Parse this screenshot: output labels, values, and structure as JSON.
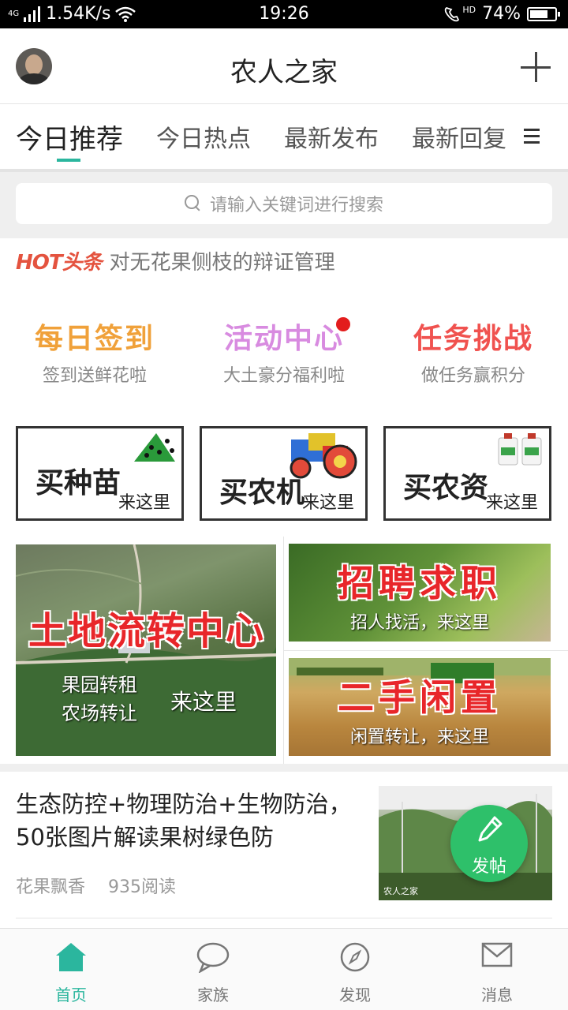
{
  "status_bar": {
    "network": "4G",
    "speed": "1.54K/s",
    "time": "19:26",
    "hd": "HD",
    "battery": "74%",
    "battery_level": 0.74
  },
  "header": {
    "title": "农人之家"
  },
  "tabs": [
    {
      "label": "今日推荐",
      "active": true
    },
    {
      "label": "今日热点",
      "active": false
    },
    {
      "label": "最新发布",
      "active": false
    },
    {
      "label": "最新回复",
      "active": false
    }
  ],
  "search": {
    "placeholder": "请输入关键词进行搜索"
  },
  "hot": {
    "badge": "HOT头条",
    "text": "对无花果侧枝的辩证管理"
  },
  "quick_links": [
    {
      "title": "每日签到",
      "subtitle": "签到送鲜花啦",
      "color": "#f0a13a"
    },
    {
      "title": "活动中心",
      "subtitle": "大土豪分福利啦",
      "color": "#d88be0"
    },
    {
      "title": "任务挑战",
      "subtitle": "做任务赢积分",
      "color": "#f0524f"
    }
  ],
  "buy_cards": [
    {
      "title": "买种苗",
      "subtitle": "来这里"
    },
    {
      "title": "买农机",
      "subtitle": "来这里"
    },
    {
      "title": "买农资",
      "subtitle": "来这里"
    }
  ],
  "tiles": {
    "land": {
      "title": "土地流转中心",
      "line1": "果园转租",
      "line2": "农场转让",
      "line3": "来这里"
    },
    "jobs": {
      "title": "招聘求职",
      "subtitle": "招人找活，来这里"
    },
    "secondhand": {
      "title": "二手闲置",
      "subtitle": "闲置转让，来这里"
    }
  },
  "article": {
    "title": "生态防控+物理防治+生物防治，50张图片解读果树绿色防",
    "author": "花果飘香",
    "reads": "935阅读",
    "thumb_watermark": "农人之家"
  },
  "fab": {
    "label": "发帖"
  },
  "bottom_nav": [
    {
      "label": "首页",
      "icon": "home-icon",
      "active": true
    },
    {
      "label": "家族",
      "icon": "chat-icon",
      "active": false
    },
    {
      "label": "发现",
      "icon": "compass-icon",
      "active": false
    },
    {
      "label": "消息",
      "icon": "mail-icon",
      "active": false
    }
  ],
  "colors": {
    "accent": "#2bb69e",
    "fab": "#2ec06a",
    "hot": "#e4533f"
  }
}
